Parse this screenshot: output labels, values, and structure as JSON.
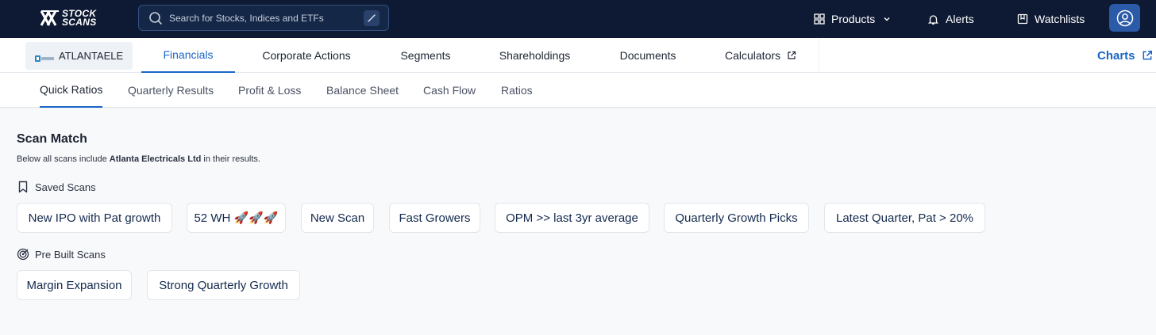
{
  "app": {
    "logo_line1": "STOCK",
    "logo_line2": "SCANS"
  },
  "search": {
    "placeholder": "Search for Stocks, Indices and ETFs",
    "shortcut": "/"
  },
  "nav": {
    "products": "Products",
    "alerts": "Alerts",
    "watchlists": "Watchlists"
  },
  "stock": {
    "symbol": "ATLANTAELE",
    "logo_text": "ATLANTA"
  },
  "primary_tabs": [
    {
      "label": "Financials",
      "active": true
    },
    {
      "label": "Corporate Actions"
    },
    {
      "label": "Segments"
    },
    {
      "label": "Shareholdings"
    },
    {
      "label": "Documents"
    },
    {
      "label": "Calculators"
    }
  ],
  "charts_label": "Charts",
  "secondary_tabs": [
    {
      "label": "Quick Ratios",
      "active": true
    },
    {
      "label": "Quarterly Results"
    },
    {
      "label": "Profit & Loss"
    },
    {
      "label": "Balance Sheet"
    },
    {
      "label": "Cash Flow"
    },
    {
      "label": "Ratios"
    }
  ],
  "scan_match": {
    "title": "Scan Match",
    "subtitle_prefix": "Below all scans include ",
    "company": "Atlanta Electricals Ltd",
    "subtitle_suffix": " in their results."
  },
  "saved_scans": {
    "label": "Saved Scans",
    "items": [
      "New IPO with Pat growth",
      "52 WH 🚀🚀🚀",
      "New Scan",
      "Fast Growers",
      "OPM >> last 3yr average",
      "Quarterly Growth Picks",
      "Latest Quarter, Pat > 20%"
    ]
  },
  "prebuilt_scans": {
    "label": "Pre Built Scans",
    "items": [
      "Margin Expansion",
      "Strong Quarterly Growth"
    ]
  },
  "colors": {
    "topbar": "#0e1a33",
    "accent": "#1a66c8",
    "chip_text": "#13294d"
  }
}
